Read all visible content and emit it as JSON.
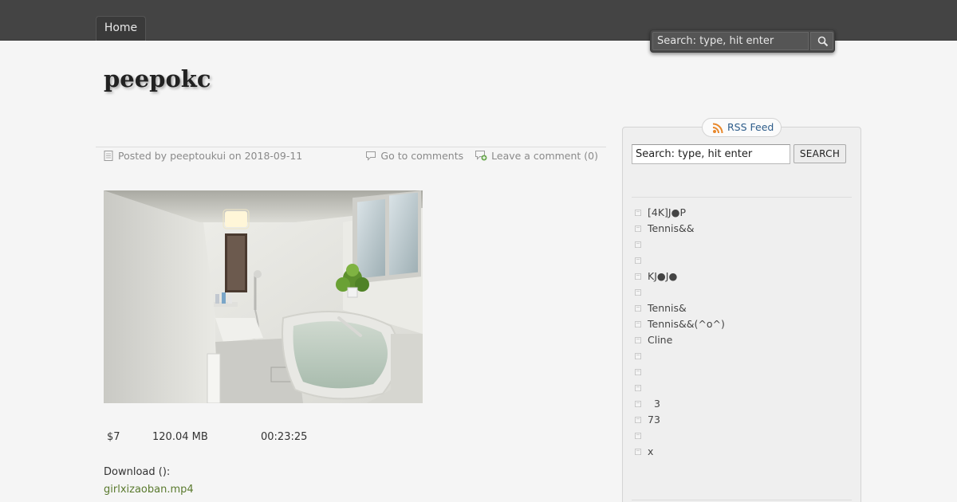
{
  "nav": {
    "home_label": "Home"
  },
  "top_search": {
    "placeholder": "Search: type, hit enter"
  },
  "site": {
    "title": "peepokc"
  },
  "post": {
    "posted_by_prefix": "Posted by",
    "author": "peeptoukui",
    "on_word": "on",
    "date": "2018-09-11",
    "go_to_comments": "Go to comments",
    "leave_comment": "Leave a comment (0)",
    "price": "$7",
    "file_size": "120.04 MB",
    "duration": "00:23:25",
    "download_label": "Download ():",
    "download_file": "girlxizaoban.mp4"
  },
  "sidebar": {
    "rss_label": "RSS Feed",
    "search_value": "Search: type, hit enter",
    "search_button": "SEARCH",
    "items": [
      {
        "label": "[4K]J●P"
      },
      {
        "label": "Tennis&&"
      },
      {
        "label": ""
      },
      {
        "label": ""
      },
      {
        "label": "KJ●J●"
      },
      {
        "label": ""
      },
      {
        "label": "Tennis&"
      },
      {
        "label": "Tennis&&(^o^)"
      },
      {
        "label": "Cline"
      },
      {
        "label": ""
      },
      {
        "label": ""
      },
      {
        "label": ""
      },
      {
        "label": "  3"
      },
      {
        "label": "73"
      },
      {
        "label": ""
      },
      {
        "label": "x"
      }
    ]
  },
  "colors": {
    "topbar": "#444444",
    "page_bg": "#f5f5f5",
    "link_green": "#5a7a2e",
    "rss_blue": "#2d5c8a"
  },
  "icons": {
    "search": "magnifier-icon",
    "post": "document-icon",
    "comments": "speech-bubble-icon",
    "leave_comment": "comment-add-icon",
    "rss": "rss-icon",
    "bullet": "list-bullet-icon"
  }
}
